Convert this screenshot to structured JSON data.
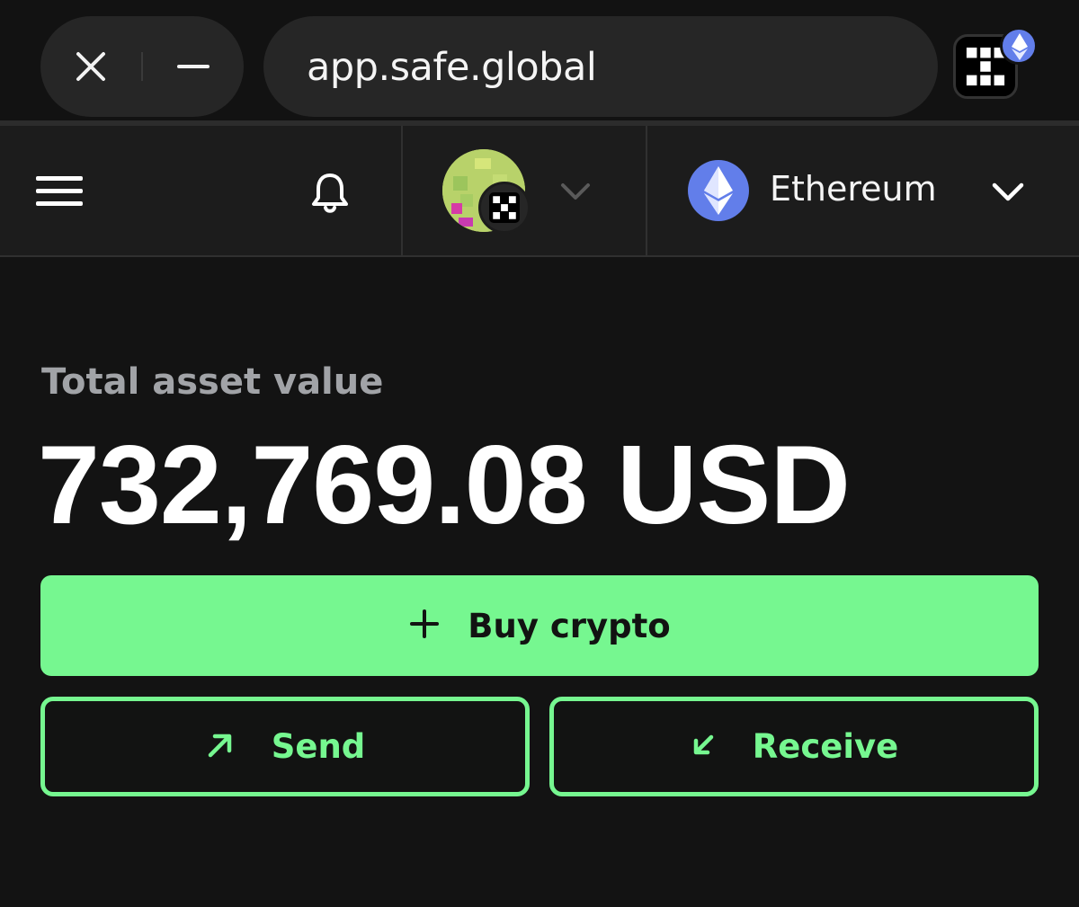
{
  "browser": {
    "url": "app.safe.global",
    "close_icon": "close-icon",
    "minimize_icon": "minimize-icon",
    "extension_icon": "okx-wallet-icon",
    "extension_network_badge": "ethereum-icon"
  },
  "header": {
    "menu_icon": "hamburger-menu-icon",
    "notifications_icon": "bell-icon",
    "account_icon": "safe-account-avatar",
    "network": {
      "name": "Ethereum",
      "icon": "ethereum-icon",
      "color": "#627eea"
    }
  },
  "main": {
    "total_label": "Total asset value",
    "total_value": "732,769.08 USD",
    "buy_button": {
      "label": "Buy crypto",
      "icon": "plus-icon"
    },
    "send_button": {
      "label": "Send",
      "icon": "arrow-up-right-icon"
    },
    "receive_button": {
      "label": "Receive",
      "icon": "arrow-down-left-icon"
    }
  },
  "colors": {
    "accent": "#76f790",
    "background": "#131313",
    "header_background": "#1c1c1c",
    "muted_text": "#a1a3a7"
  }
}
